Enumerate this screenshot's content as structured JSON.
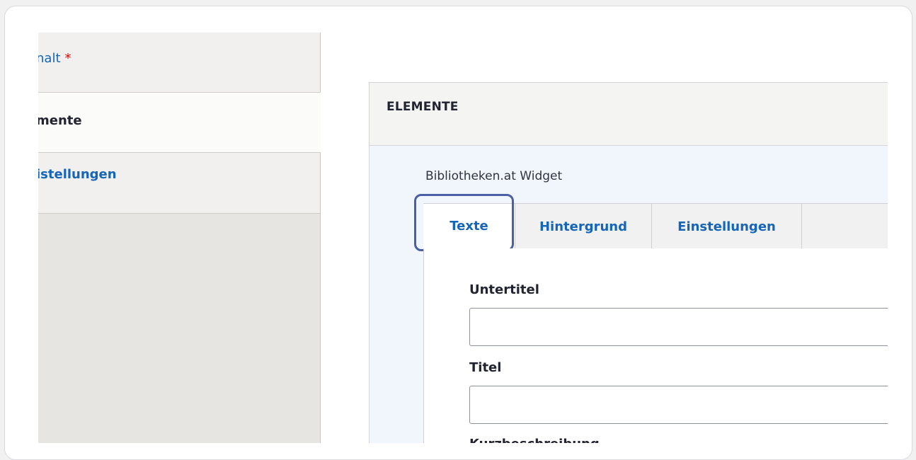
{
  "vertical_tabs": {
    "items": [
      {
        "label": "nalt",
        "required_marker": "*"
      },
      {
        "label": "mente"
      },
      {
        "label": "istellungen"
      }
    ]
  },
  "elements": {
    "title": "ELEMENTE",
    "widget_label": "Bibliotheken.at Widget",
    "tabs": [
      {
        "label": "Texte"
      },
      {
        "label": "Hintergrund"
      },
      {
        "label": "Einstellungen"
      }
    ],
    "fields": [
      {
        "label": "Untertitel",
        "value": ""
      },
      {
        "label": "Titel",
        "value": ""
      },
      {
        "label": "Kurzbeschreibung"
      }
    ]
  },
  "colors": {
    "link_blue": "#1565b8",
    "focus_ring": "#4a5fa8",
    "required_red": "#e00000"
  }
}
